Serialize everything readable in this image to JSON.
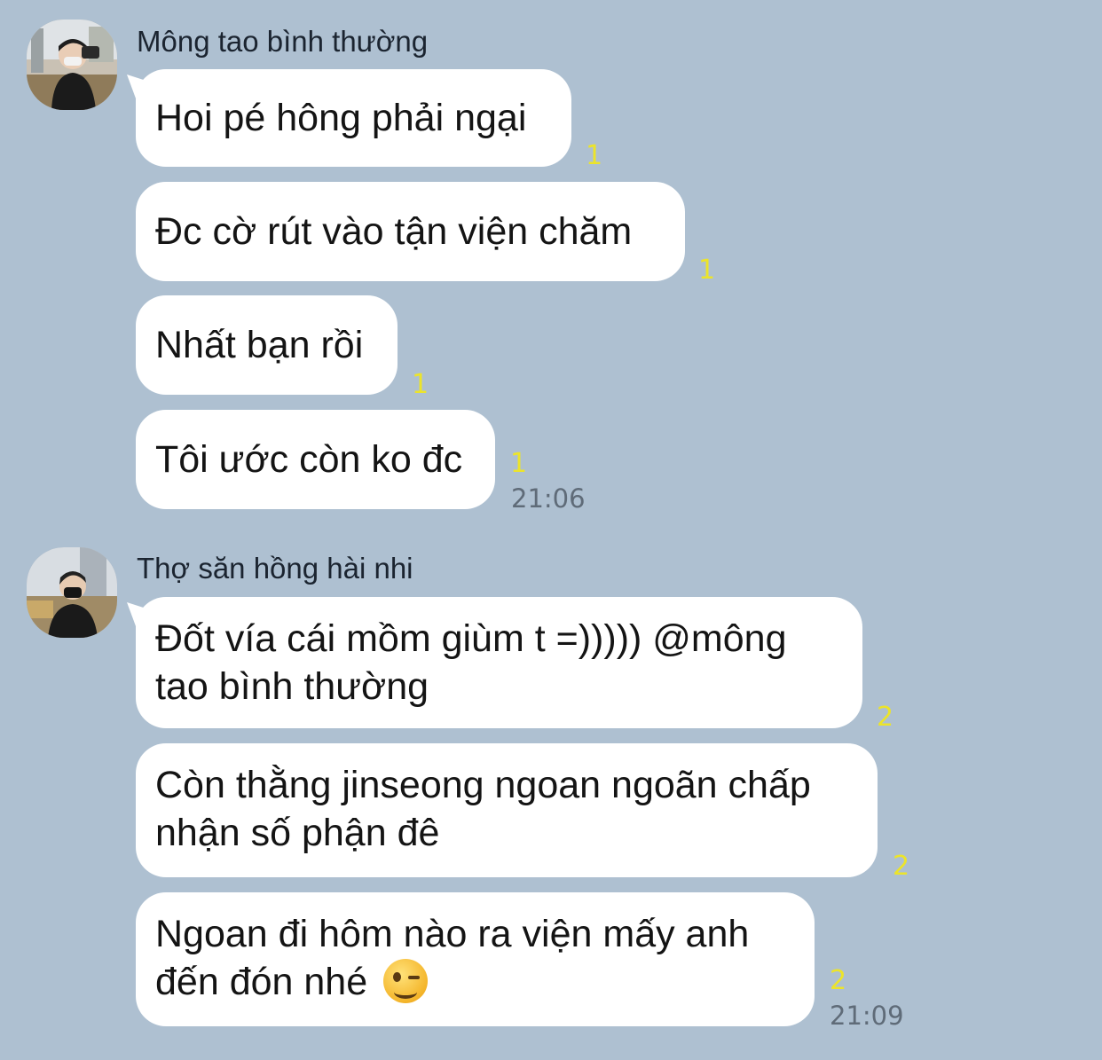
{
  "groups": [
    {
      "sender": "Mông tao bình thường",
      "avatar_icon": "user-avatar-photo",
      "messages": [
        {
          "text": "Hoi pé hông phải ngại",
          "unread": "1"
        },
        {
          "text": "Đc cờ rút vào tận viện chăm",
          "unread": "1"
        },
        {
          "text": "Nhất bạn rồi",
          "unread": "1"
        },
        {
          "text": "Tôi ước còn ko đc",
          "unread": "1",
          "time": "21:06"
        }
      ]
    },
    {
      "sender": "Thợ săn hồng hài nhi",
      "avatar_icon": "user-avatar-photo",
      "messages": [
        {
          "text": "Đốt vía cái mồm giùm t =))))) @mông tao bình thường",
          "unread": "2"
        },
        {
          "text": "Còn thằng jinseong ngoan ngoãn chấp nhận số phận đê",
          "unread": "2"
        },
        {
          "text": "Ngoan đi hôm nào ra viện mấy anh đến đón nhé",
          "emoji": "winking-face-emoji",
          "unread": "2",
          "time": "21:09"
        }
      ]
    }
  ],
  "colors": {
    "background": "#aec0d1",
    "bubble": "#ffffff",
    "unread": "#ece42a",
    "time": "#5f6b78"
  }
}
